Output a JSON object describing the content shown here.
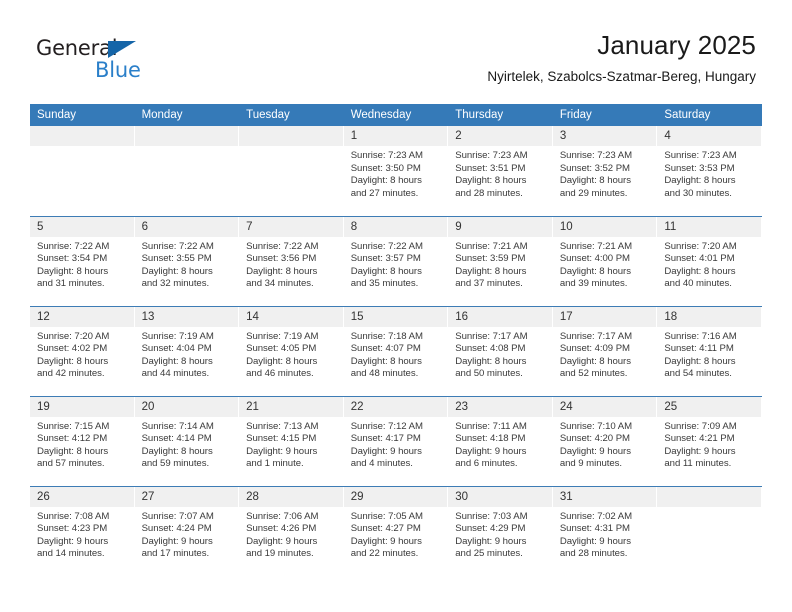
{
  "logo": {
    "line1": "General",
    "line2": "Blue",
    "triangle_color": "#1565a8",
    "text_color": "#231f20",
    "blue_color": "#2a7fc9"
  },
  "header": {
    "title": "January 2025",
    "subtitle": "Nyirtelek, Szabolcs-Szatmar-Bereg, Hungary"
  },
  "theme": {
    "header_bg": "#357ab8",
    "daynum_bg": "#f0f0f0",
    "row_divider": "#3d7cb5"
  },
  "weekdays": [
    "Sunday",
    "Monday",
    "Tuesday",
    "Wednesday",
    "Thursday",
    "Friday",
    "Saturday"
  ],
  "weeks": [
    [
      {
        "day": "",
        "empty": true
      },
      {
        "day": "",
        "empty": true
      },
      {
        "day": "",
        "empty": true
      },
      {
        "day": "1",
        "sunrise": "Sunrise: 7:23 AM",
        "sunset": "Sunset: 3:50 PM",
        "daylight1": "Daylight: 8 hours",
        "daylight2": "and 27 minutes."
      },
      {
        "day": "2",
        "sunrise": "Sunrise: 7:23 AM",
        "sunset": "Sunset: 3:51 PM",
        "daylight1": "Daylight: 8 hours",
        "daylight2": "and 28 minutes."
      },
      {
        "day": "3",
        "sunrise": "Sunrise: 7:23 AM",
        "sunset": "Sunset: 3:52 PM",
        "daylight1": "Daylight: 8 hours",
        "daylight2": "and 29 minutes."
      },
      {
        "day": "4",
        "sunrise": "Sunrise: 7:23 AM",
        "sunset": "Sunset: 3:53 PM",
        "daylight1": "Daylight: 8 hours",
        "daylight2": "and 30 minutes."
      }
    ],
    [
      {
        "day": "5",
        "sunrise": "Sunrise: 7:22 AM",
        "sunset": "Sunset: 3:54 PM",
        "daylight1": "Daylight: 8 hours",
        "daylight2": "and 31 minutes."
      },
      {
        "day": "6",
        "sunrise": "Sunrise: 7:22 AM",
        "sunset": "Sunset: 3:55 PM",
        "daylight1": "Daylight: 8 hours",
        "daylight2": "and 32 minutes."
      },
      {
        "day": "7",
        "sunrise": "Sunrise: 7:22 AM",
        "sunset": "Sunset: 3:56 PM",
        "daylight1": "Daylight: 8 hours",
        "daylight2": "and 34 minutes."
      },
      {
        "day": "8",
        "sunrise": "Sunrise: 7:22 AM",
        "sunset": "Sunset: 3:57 PM",
        "daylight1": "Daylight: 8 hours",
        "daylight2": "and 35 minutes."
      },
      {
        "day": "9",
        "sunrise": "Sunrise: 7:21 AM",
        "sunset": "Sunset: 3:59 PM",
        "daylight1": "Daylight: 8 hours",
        "daylight2": "and 37 minutes."
      },
      {
        "day": "10",
        "sunrise": "Sunrise: 7:21 AM",
        "sunset": "Sunset: 4:00 PM",
        "daylight1": "Daylight: 8 hours",
        "daylight2": "and 39 minutes."
      },
      {
        "day": "11",
        "sunrise": "Sunrise: 7:20 AM",
        "sunset": "Sunset: 4:01 PM",
        "daylight1": "Daylight: 8 hours",
        "daylight2": "and 40 minutes."
      }
    ],
    [
      {
        "day": "12",
        "sunrise": "Sunrise: 7:20 AM",
        "sunset": "Sunset: 4:02 PM",
        "daylight1": "Daylight: 8 hours",
        "daylight2": "and 42 minutes."
      },
      {
        "day": "13",
        "sunrise": "Sunrise: 7:19 AM",
        "sunset": "Sunset: 4:04 PM",
        "daylight1": "Daylight: 8 hours",
        "daylight2": "and 44 minutes."
      },
      {
        "day": "14",
        "sunrise": "Sunrise: 7:19 AM",
        "sunset": "Sunset: 4:05 PM",
        "daylight1": "Daylight: 8 hours",
        "daylight2": "and 46 minutes."
      },
      {
        "day": "15",
        "sunrise": "Sunrise: 7:18 AM",
        "sunset": "Sunset: 4:07 PM",
        "daylight1": "Daylight: 8 hours",
        "daylight2": "and 48 minutes."
      },
      {
        "day": "16",
        "sunrise": "Sunrise: 7:17 AM",
        "sunset": "Sunset: 4:08 PM",
        "daylight1": "Daylight: 8 hours",
        "daylight2": "and 50 minutes."
      },
      {
        "day": "17",
        "sunrise": "Sunrise: 7:17 AM",
        "sunset": "Sunset: 4:09 PM",
        "daylight1": "Daylight: 8 hours",
        "daylight2": "and 52 minutes."
      },
      {
        "day": "18",
        "sunrise": "Sunrise: 7:16 AM",
        "sunset": "Sunset: 4:11 PM",
        "daylight1": "Daylight: 8 hours",
        "daylight2": "and 54 minutes."
      }
    ],
    [
      {
        "day": "19",
        "sunrise": "Sunrise: 7:15 AM",
        "sunset": "Sunset: 4:12 PM",
        "daylight1": "Daylight: 8 hours",
        "daylight2": "and 57 minutes."
      },
      {
        "day": "20",
        "sunrise": "Sunrise: 7:14 AM",
        "sunset": "Sunset: 4:14 PM",
        "daylight1": "Daylight: 8 hours",
        "daylight2": "and 59 minutes."
      },
      {
        "day": "21",
        "sunrise": "Sunrise: 7:13 AM",
        "sunset": "Sunset: 4:15 PM",
        "daylight1": "Daylight: 9 hours",
        "daylight2": "and 1 minute."
      },
      {
        "day": "22",
        "sunrise": "Sunrise: 7:12 AM",
        "sunset": "Sunset: 4:17 PM",
        "daylight1": "Daylight: 9 hours",
        "daylight2": "and 4 minutes."
      },
      {
        "day": "23",
        "sunrise": "Sunrise: 7:11 AM",
        "sunset": "Sunset: 4:18 PM",
        "daylight1": "Daylight: 9 hours",
        "daylight2": "and 6 minutes."
      },
      {
        "day": "24",
        "sunrise": "Sunrise: 7:10 AM",
        "sunset": "Sunset: 4:20 PM",
        "daylight1": "Daylight: 9 hours",
        "daylight2": "and 9 minutes."
      },
      {
        "day": "25",
        "sunrise": "Sunrise: 7:09 AM",
        "sunset": "Sunset: 4:21 PM",
        "daylight1": "Daylight: 9 hours",
        "daylight2": "and 11 minutes."
      }
    ],
    [
      {
        "day": "26",
        "sunrise": "Sunrise: 7:08 AM",
        "sunset": "Sunset: 4:23 PM",
        "daylight1": "Daylight: 9 hours",
        "daylight2": "and 14 minutes."
      },
      {
        "day": "27",
        "sunrise": "Sunrise: 7:07 AM",
        "sunset": "Sunset: 4:24 PM",
        "daylight1": "Daylight: 9 hours",
        "daylight2": "and 17 minutes."
      },
      {
        "day": "28",
        "sunrise": "Sunrise: 7:06 AM",
        "sunset": "Sunset: 4:26 PM",
        "daylight1": "Daylight: 9 hours",
        "daylight2": "and 19 minutes."
      },
      {
        "day": "29",
        "sunrise": "Sunrise: 7:05 AM",
        "sunset": "Sunset: 4:27 PM",
        "daylight1": "Daylight: 9 hours",
        "daylight2": "and 22 minutes."
      },
      {
        "day": "30",
        "sunrise": "Sunrise: 7:03 AM",
        "sunset": "Sunset: 4:29 PM",
        "daylight1": "Daylight: 9 hours",
        "daylight2": "and 25 minutes."
      },
      {
        "day": "31",
        "sunrise": "Sunrise: 7:02 AM",
        "sunset": "Sunset: 4:31 PM",
        "daylight1": "Daylight: 9 hours",
        "daylight2": "and 28 minutes."
      },
      {
        "day": "",
        "empty": true
      }
    ]
  ]
}
